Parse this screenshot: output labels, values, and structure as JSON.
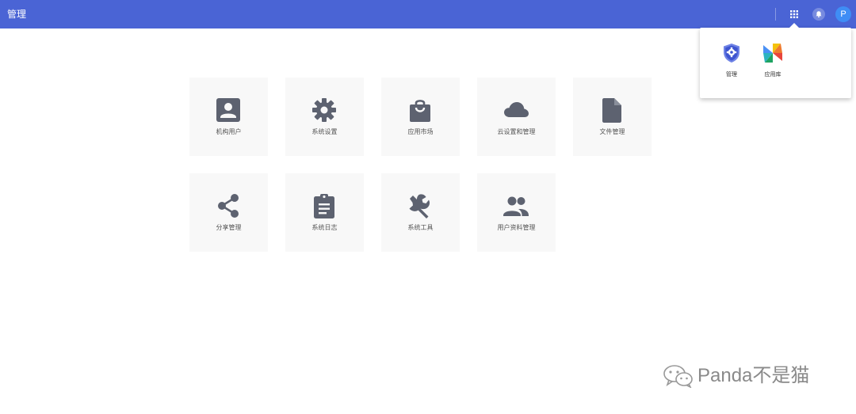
{
  "header": {
    "title": "管理",
    "avatar_initial": "P",
    "apps_icon": "apps-grid-icon",
    "bell_icon": "bell-icon"
  },
  "colors": {
    "header_bg": "#4a64d5",
    "tile_bg": "#f8f8f8",
    "tile_icon": "#5d6270",
    "avatar_bg": "#3f8df5"
  },
  "app_switcher": {
    "items": [
      {
        "label": "管理",
        "icon": "shield-gear-icon"
      },
      {
        "label": "应用库",
        "icon": "pinwheel-icon"
      }
    ]
  },
  "tiles": [
    {
      "label": "机构用户",
      "icon": "account-box-icon"
    },
    {
      "label": "系统设置",
      "icon": "gear-icon"
    },
    {
      "label": "应用市场",
      "icon": "shopping-bag-icon"
    },
    {
      "label": "云设置和管理",
      "icon": "cloud-icon"
    },
    {
      "label": "文件管理",
      "icon": "file-icon"
    },
    {
      "label": "分享管理",
      "icon": "share-icon"
    },
    {
      "label": "系统日志",
      "icon": "clipboard-icon"
    },
    {
      "label": "系统工具",
      "icon": "wrench-icon"
    },
    {
      "label": "用户资料管理",
      "icon": "people-icon"
    }
  ],
  "watermark": {
    "text": "Panda不是猫",
    "icon": "wechat-icon"
  }
}
